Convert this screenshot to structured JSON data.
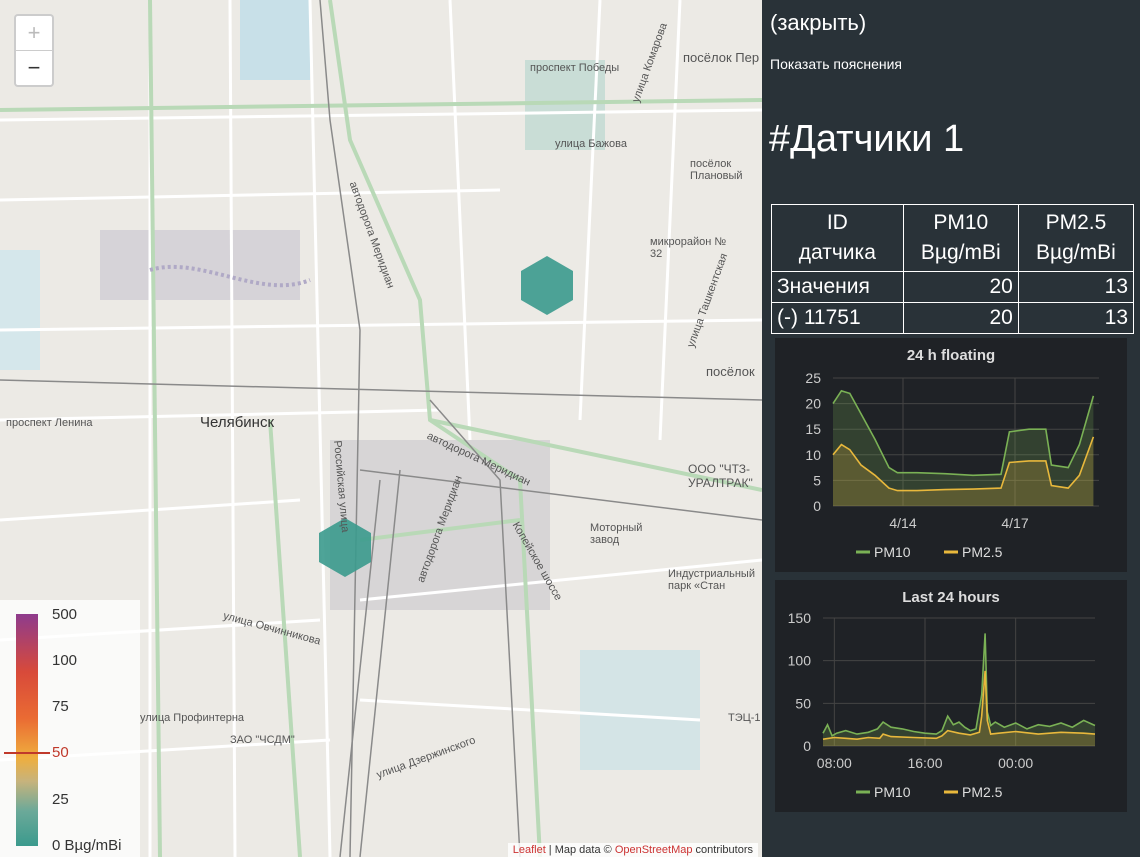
{
  "map": {
    "zoom_in": "+",
    "zoom_out": "−",
    "labels": {
      "city": "Челябинск",
      "pobedy": "проспект Победы",
      "perv": "посёлок Пер",
      "bazhova": "улица Бажова",
      "komarova": "улица Комарова",
      "planovy": "посёлок Плановый",
      "mikro": "микрорайон № 32",
      "tash": "улица Ташкентская",
      "lenina": "проспект Ленина",
      "meridian1": "автодорога Меридиан",
      "meridian2": "автодорога Меридиан",
      "meridian3": "автодорога Меридиан",
      "chtz": "ООО \"ЧТЗ-УРАЛТРАК\"",
      "motor": "Моторный завод",
      "industr": "Индустриальный парк «Стан",
      "kopeysk": "Копейское шоссе",
      "ovch": "улица Овчинникова",
      "prof": "улица Профинтерна",
      "chsdm": "ЗАО \"ЧСДМ\"",
      "dzerzh": "улица Дзержинского",
      "tec": "ТЭЦ-1",
      "posel": "посёлок",
      "ross": "Российская улица"
    },
    "attribution": {
      "leaflet": "Leaflet",
      "mid": " | Map data ©",
      "osm": "OpenStreetMap",
      "tail": " contributors"
    }
  },
  "legend": {
    "ticks": [
      "500",
      "100",
      "75",
      "50",
      "25",
      "0 Bµg/mBi"
    ],
    "highlight": "50"
  },
  "panel": {
    "close": "(закрыть)",
    "explain": "Показать пояснения",
    "title": "#Датчики 1",
    "table": {
      "h_id_1": "ID",
      "h_id_2": "датчика",
      "h_pm10_1": "PM10",
      "h_pm10_2": "Bµg/mBi",
      "h_pm25_1": "PM2.5",
      "h_pm25_2": "Bµg/mBi",
      "rows": [
        {
          "label": "Значения",
          "pm10": "20",
          "pm25": "13"
        },
        {
          "label": "(-) 11751",
          "pm10": "20",
          "pm25": "13"
        }
      ]
    }
  },
  "chart_data": [
    {
      "type": "area",
      "title": "24 h floating",
      "ylim": [
        0,
        25
      ],
      "yticks": [
        0,
        5,
        10,
        15,
        20,
        25
      ],
      "xlim": [
        0,
        9.5
      ],
      "xticks": [
        {
          "x": 2.5,
          "label": "4/14"
        },
        {
          "x": 6.5,
          "label": "4/17"
        }
      ],
      "colors": {
        "PM10": "#7ab155",
        "PM2.5": "#e8b83c"
      },
      "series": [
        {
          "name": "PM10",
          "x": [
            0,
            0.3,
            0.6,
            1.0,
            1.5,
            2.0,
            2.3,
            3.0,
            4.0,
            5.0,
            6.0,
            6.3,
            7.0,
            7.6,
            7.8,
            8.4,
            8.8,
            9.3
          ],
          "values": [
            20,
            22.5,
            22,
            18,
            13,
            7.5,
            6.5,
            6.5,
            6.3,
            6.0,
            6.2,
            14.5,
            15,
            15,
            8,
            7.5,
            12,
            21.5
          ]
        },
        {
          "name": "PM2.5",
          "x": [
            0,
            0.3,
            0.6,
            1.0,
            1.5,
            2.0,
            2.3,
            3.0,
            4.0,
            5.0,
            6.0,
            6.3,
            7.0,
            7.6,
            7.8,
            8.4,
            8.8,
            9.3
          ],
          "values": [
            10,
            12,
            11,
            8,
            6,
            3.5,
            3.0,
            3.0,
            3.2,
            3.3,
            3.5,
            8.5,
            8.8,
            8.8,
            4,
            3.5,
            6,
            13.5
          ]
        }
      ]
    },
    {
      "type": "area",
      "title": "Last 24 hours",
      "ylim": [
        0,
        150
      ],
      "yticks": [
        0,
        50,
        100,
        150
      ],
      "xlim": [
        0,
        24
      ],
      "xticks": [
        {
          "x": 1.0,
          "label": "08:00"
        },
        {
          "x": 9.0,
          "label": "16:00"
        },
        {
          "x": 17.0,
          "label": "00:00"
        }
      ],
      "colors": {
        "PM10": "#7ab155",
        "PM2.5": "#e8b83c"
      },
      "series": [
        {
          "name": "PM10",
          "x": [
            0,
            0.4,
            0.8,
            1.2,
            2,
            3,
            4,
            4.8,
            5.3,
            6,
            7,
            8,
            9,
            10,
            10.5,
            11,
            11.5,
            12,
            12.5,
            13,
            13.5,
            14,
            14.3,
            14.5,
            14.8,
            15.2,
            16,
            17,
            18,
            19,
            20,
            21,
            22,
            23,
            24
          ],
          "values": [
            15,
            25,
            12,
            15,
            18,
            14,
            16,
            20,
            28,
            22,
            20,
            17,
            15,
            14,
            18,
            35,
            25,
            28,
            22,
            18,
            20,
            60,
            132,
            40,
            24,
            28,
            22,
            27,
            20,
            25,
            23,
            27,
            22,
            30,
            24
          ]
        },
        {
          "name": "PM2.5",
          "x": [
            0,
            1,
            2,
            3,
            4,
            5,
            5.3,
            6,
            8,
            10,
            10.5,
            11,
            12,
            13,
            13.8,
            14,
            14.3,
            14.5,
            14.8,
            15.5,
            17,
            19,
            21,
            23,
            24
          ],
          "values": [
            8,
            10,
            9,
            8,
            10,
            9,
            14,
            11,
            10,
            9,
            12,
            18,
            15,
            13,
            16,
            35,
            88,
            30,
            14,
            15,
            17,
            14,
            16,
            15,
            14
          ]
        }
      ]
    }
  ]
}
